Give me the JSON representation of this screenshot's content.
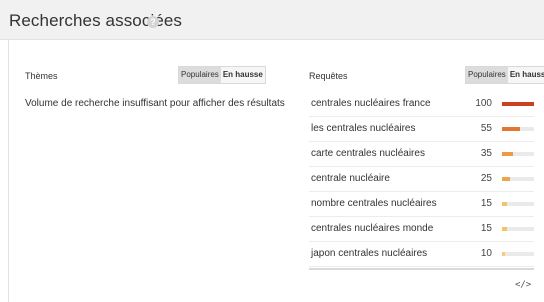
{
  "header": {
    "title": "Recherches associées",
    "help_icon": "question-icon",
    "help_glyph": "?"
  },
  "themes": {
    "label": "Thèmes",
    "toggle": {
      "popular": "Populaires",
      "rising": "En hausse",
      "selected": "popular"
    },
    "message": "Volume de recherche insuffisant pour afficher des résultats"
  },
  "queries": {
    "label": "Requêtes",
    "toggle": {
      "popular": "Populaires",
      "rising": "En hausse",
      "selected": "popular"
    },
    "rows": [
      {
        "label": "centrales nucléaires france",
        "value": 100,
        "color": "#c9411f"
      },
      {
        "label": "les centrales nucléaires",
        "value": 55,
        "color": "#e2772f"
      },
      {
        "label": "carte centrales nucléaires",
        "value": 35,
        "color": "#ec9a45"
      },
      {
        "label": "centrale nucléaire",
        "value": 25,
        "color": "#efa350"
      },
      {
        "label": "nombre centrales nucléaires",
        "value": 15,
        "color": "#f5c26b"
      },
      {
        "label": "centrales nucléaires monde",
        "value": 15,
        "color": "#f5c26b"
      },
      {
        "label": "japon centrales nucléaires",
        "value": 10,
        "color": "#f7cd7c"
      }
    ]
  },
  "footer": {
    "embed_icon": "embed-code-icon",
    "embed_glyph": "</>"
  }
}
